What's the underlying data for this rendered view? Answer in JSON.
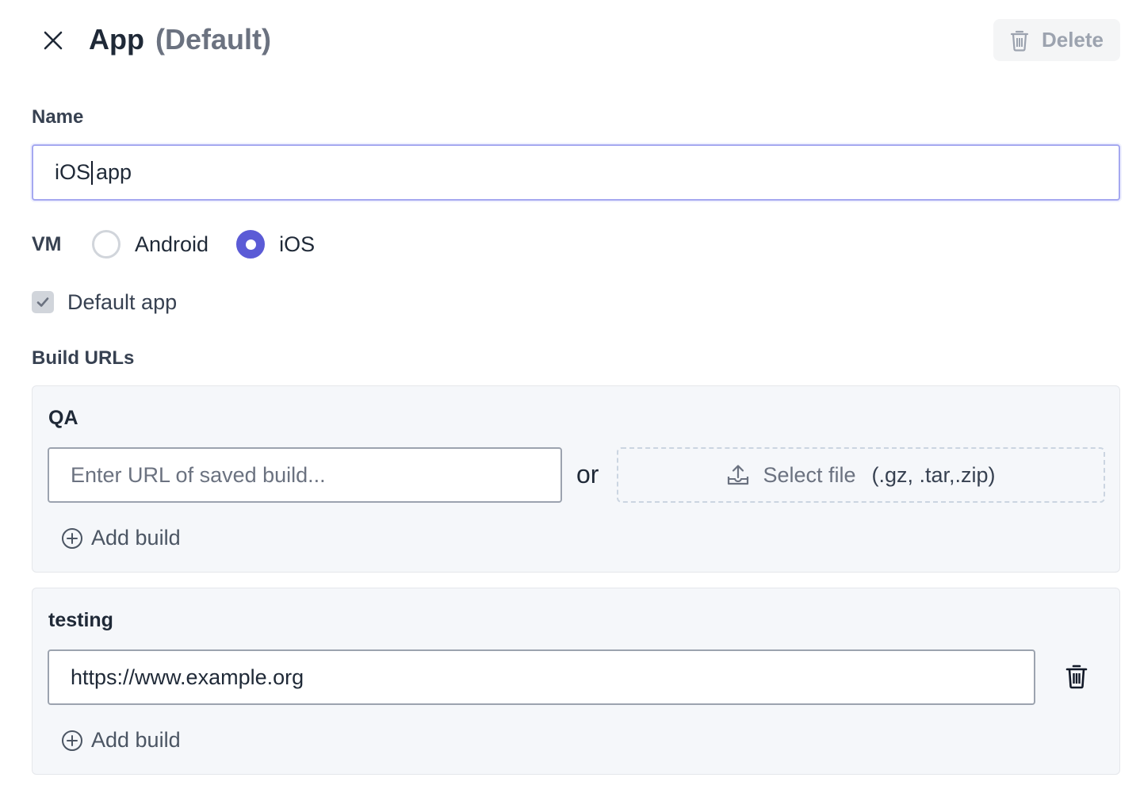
{
  "header": {
    "title": "App",
    "subtitle": "(Default)",
    "delete_label": "Delete"
  },
  "form": {
    "name_label": "Name",
    "name_value": "iOS",
    "name_value_after_caret": "app",
    "vm_label": "VM",
    "vm_options": [
      {
        "label": "Android",
        "selected": false
      },
      {
        "label": "iOS",
        "selected": true
      }
    ],
    "default_app_label": "Default app",
    "default_app_checked": true,
    "build_urls_label": "Build URLs"
  },
  "environments": [
    {
      "name": "QA",
      "url_placeholder": "Enter URL of saved build...",
      "or_label": "or",
      "select_file_label": "Select file",
      "file_types_hint": "(.gz, .tar,.zip)",
      "add_build_label": "Add build"
    },
    {
      "name": "testing",
      "url_value": "https://www.example.org",
      "add_build_label": "Add build"
    }
  ],
  "colors": {
    "accent": "#5b5bd6",
    "focus_border": "#a5a8f0",
    "panel_bg": "#f5f7fa",
    "muted_text": "#6b7280"
  },
  "icons": {
    "close": "close-icon",
    "delete": "trash-icon",
    "upload": "upload-icon",
    "add": "plus-circle-icon",
    "checkmark": "check-icon"
  }
}
